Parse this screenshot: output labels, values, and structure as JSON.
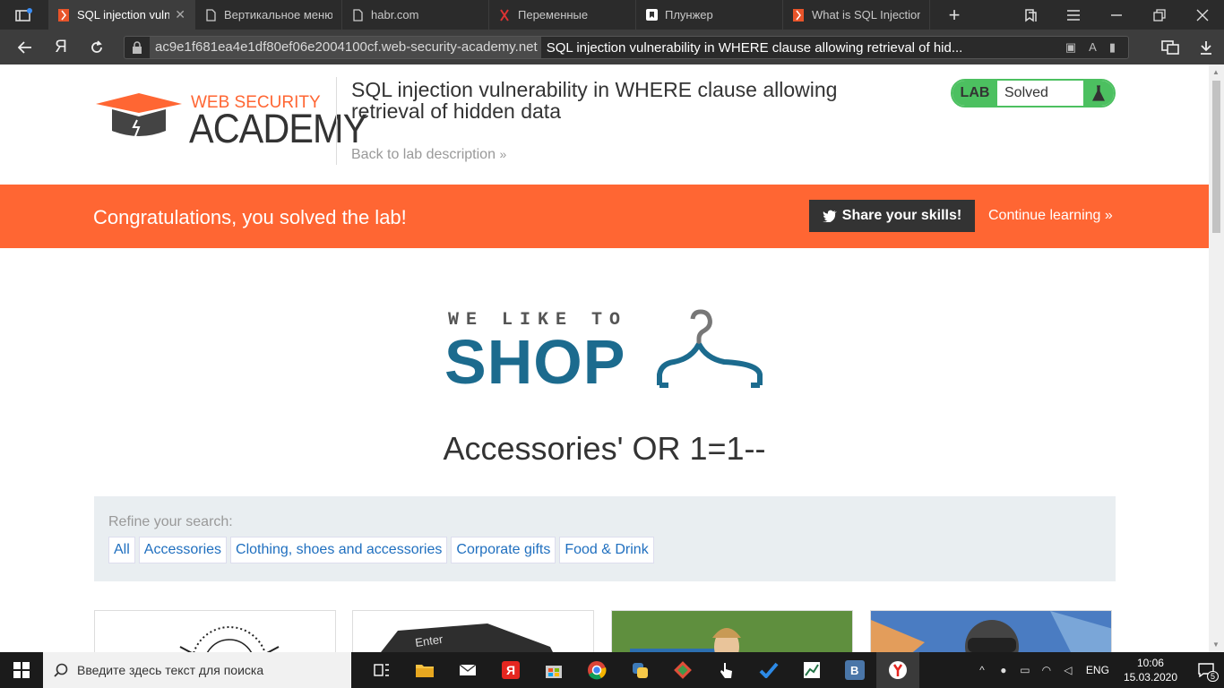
{
  "browser": {
    "tabs": [
      {
        "label": "SQL injection vulne",
        "active": true,
        "icon": "portswigger-icon"
      },
      {
        "label": "Вертикальное меню",
        "active": false,
        "icon": "page-icon"
      },
      {
        "label": "habr.com",
        "active": false,
        "icon": "page-icon"
      },
      {
        "label": "Переменные",
        "active": false,
        "icon": "portswigger-icon"
      },
      {
        "label": "Плунжер",
        "active": false,
        "icon": "bookmark-icon"
      },
      {
        "label": "What is SQL Injection",
        "active": false,
        "icon": "portswigger-icon"
      }
    ],
    "url_host": "ac9e1f681ea4e1df80ef06e2004100cf.web-security-academy.net",
    "url_title": "SQL injection vulnerability in WHERE clause allowing retrieval of hid...",
    "yandex_letter": "Я"
  },
  "header": {
    "logo_top": "WEB SECURITY",
    "logo_bottom": "ACADEMY",
    "lab_title": "SQL injection vulnerability in WHERE clause allowing retrieval of hidden data",
    "back_link": "Back to lab description",
    "badge_lab": "LAB",
    "badge_status": "Solved"
  },
  "banner": {
    "message": "Congratulations, you solved the lab!",
    "share": "Share your skills!",
    "continue": "Continue learning"
  },
  "shop": {
    "tagline": "WE LIKE TO",
    "brand": "SHOP",
    "heading": "Accessories' OR 1=1--",
    "refine_label": "Refine your search:",
    "filters": [
      "All",
      "Accessories",
      "Clothing, shoes and accessories",
      "Corporate gifts",
      "Food & Drink"
    ],
    "keyboard_text": "Enter"
  },
  "taskbar": {
    "search_placeholder": "Введите здесь текст для поиска",
    "lang": "ENG",
    "time": "10:06",
    "date": "15.03.2020",
    "notif_count": "5",
    "vk_letter": "B"
  },
  "colors": {
    "accent": "#ff6633",
    "lab_green": "#4cc060",
    "shop_blue": "#1c6b8e",
    "link_blue": "#1f6fbf"
  }
}
